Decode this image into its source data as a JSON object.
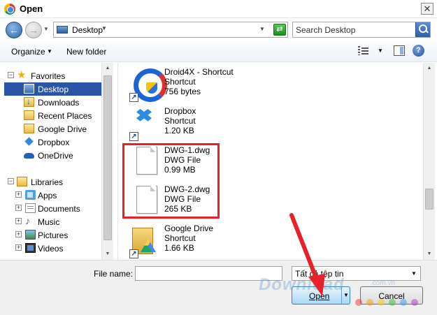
{
  "window": {
    "title": "Open",
    "close_glyph": "✕"
  },
  "address": {
    "location": "Desktop",
    "search_placeholder": "Search Desktop"
  },
  "toolbar": {
    "organize": "Organize",
    "new_folder": "New folder",
    "help_glyph": "?"
  },
  "sidebar": {
    "favorites": {
      "label": "Favorites",
      "items": [
        {
          "label": "Desktop",
          "icon": "desktop-icon",
          "selected": true
        },
        {
          "label": "Downloads",
          "icon": "downloads-icon"
        },
        {
          "label": "Recent Places",
          "icon": "recent-places-icon"
        },
        {
          "label": "Google Drive",
          "icon": "google-drive-icon"
        },
        {
          "label": "Dropbox",
          "icon": "dropbox-icon"
        },
        {
          "label": "OneDrive",
          "icon": "onedrive-icon"
        }
      ]
    },
    "libraries": {
      "label": "Libraries",
      "items": [
        {
          "label": "Apps",
          "icon": "apps-icon"
        },
        {
          "label": "Documents",
          "icon": "documents-icon"
        },
        {
          "label": "Music",
          "icon": "music-icon"
        },
        {
          "label": "Pictures",
          "icon": "pictures-icon"
        },
        {
          "label": "Videos",
          "icon": "videos-icon"
        }
      ]
    }
  },
  "files": [
    {
      "name": "Droid4X - Shortcut",
      "type": "Shortcut",
      "size": "756 bytes",
      "icon": "droid4x-icon"
    },
    {
      "name": "Dropbox",
      "type": "Shortcut",
      "size": "1.20 KB",
      "icon": "dropbox-icon"
    },
    {
      "name": "DWG-1.dwg",
      "type": "DWG File",
      "size": "0.99 MB",
      "icon": "document-icon"
    },
    {
      "name": "DWG-2.dwg",
      "type": "DWG File",
      "size": "265 KB",
      "icon": "document-icon"
    },
    {
      "name": "Google Drive",
      "type": "Shortcut",
      "size": "1.66 KB",
      "icon": "google-drive-folder-icon"
    }
  ],
  "bottom": {
    "file_name_label": "File name:",
    "file_name_value": "",
    "file_type": "Tất cả tệp tin",
    "open_label": "Open",
    "cancel_label": "Cancel"
  },
  "watermark": {
    "text": "Download",
    "sub": ".com.vn"
  },
  "colors": {
    "selection": "#2a55a6",
    "highlight": "#e8202a",
    "accent": "#3c7fb1"
  }
}
